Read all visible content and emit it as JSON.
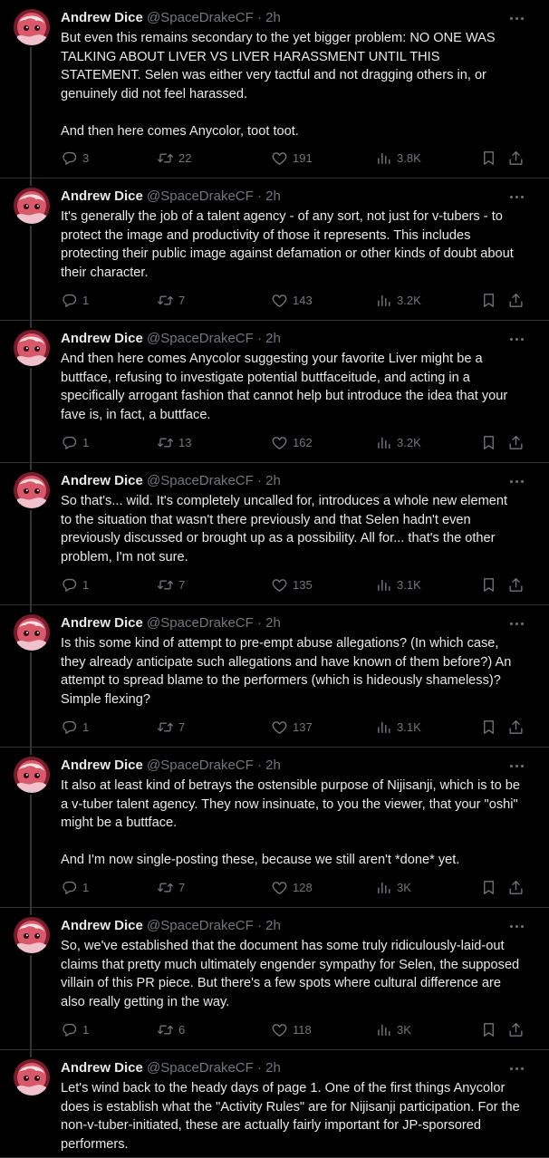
{
  "author": {
    "name": "Andrew Dice",
    "handle": "@SpaceDrakeCF",
    "separator": "·",
    "time": "2h"
  },
  "tweets": [
    {
      "paragraphs": [
        "But even this remains secondary to the yet bigger problem: NO ONE WAS TALKING ABOUT LIVER VS LIVER HARASSMENT UNTIL THIS STATEMENT. Selen was either very tactful and not dragging others in, or genuinely did not feel harassed.",
        "And then here comes Anycolor, toot toot."
      ],
      "replies": "3",
      "retweets": "22",
      "likes": "191",
      "views": "3.8K"
    },
    {
      "paragraphs": [
        "It's generally the job of a talent agency - of any sort, not just for v-tubers - to protect the image and productivity of those it represents. This includes protecting their public image against defamation or other kinds of doubt about their character."
      ],
      "replies": "1",
      "retweets": "7",
      "likes": "143",
      "views": "3.2K"
    },
    {
      "paragraphs": [
        "And then here comes Anycolor suggesting your favorite Liver might be a buttface, refusing to investigate potential buttfaceitude, and acting in a specifically arrogant fashion that cannot help but introduce the idea that your fave is, in fact, a buttface."
      ],
      "replies": "1",
      "retweets": "13",
      "likes": "162",
      "views": "3.2K"
    },
    {
      "paragraphs": [
        "So that's... wild. It's completely uncalled for, introduces a whole new element to the situation that wasn't there previously and that Selen hadn't even previously discussed or brought up as a possibility. All for... that's the other problem, I'm not sure."
      ],
      "replies": "1",
      "retweets": "7",
      "likes": "135",
      "views": "3.1K"
    },
    {
      "paragraphs": [
        "Is this some kind of attempt to pre-empt abuse allegations? (In which case, they already anticipate such allegations and have known of them before?) An attempt to spread blame to the performers (which is hideously shameless)? Simple flexing?"
      ],
      "replies": "1",
      "retweets": "7",
      "likes": "137",
      "views": "3.1K"
    },
    {
      "paragraphs": [
        "It also at least kind of betrays the ostensible purpose of Nijisanji, which is to be a v-tuber talent agency. They now insinuate, to you the viewer, that your \"oshi\" might be a buttface.",
        "And I'm now single-posting these, because we still aren't *done* yet."
      ],
      "replies": "1",
      "retweets": "7",
      "likes": "128",
      "views": "3K"
    },
    {
      "paragraphs": [
        "So, we've established that the document has some truly ridiculously-laid-out claims that pretty much ultimately engender sympathy for Selen, the supposed villain of this PR piece. But there's a few spots where cultural difference are also really getting in the way."
      ],
      "replies": "1",
      "retweets": "6",
      "likes": "118",
      "views": "3K"
    },
    {
      "paragraphs": [
        "Let's wind back to the heady days of page 1. One of the first things Anycolor does is establish what the \"Activity Rules\" are for Nijisanji participation. For the non-v-tuber-initiated, these are actually fairly important for JP-sporsored performers."
      ]
    }
  ],
  "icons": {
    "reply": "reply-icon",
    "retweet": "retweet-icon",
    "like": "heart-icon",
    "views": "views-icon",
    "bookmark": "bookmark-icon",
    "share": "share-icon",
    "more": "more-icon"
  },
  "colors": {
    "background": "#000000",
    "text": "#e7e9ea",
    "secondary": "#71767b",
    "divider": "#2f3336",
    "thread_line": "#333639"
  }
}
